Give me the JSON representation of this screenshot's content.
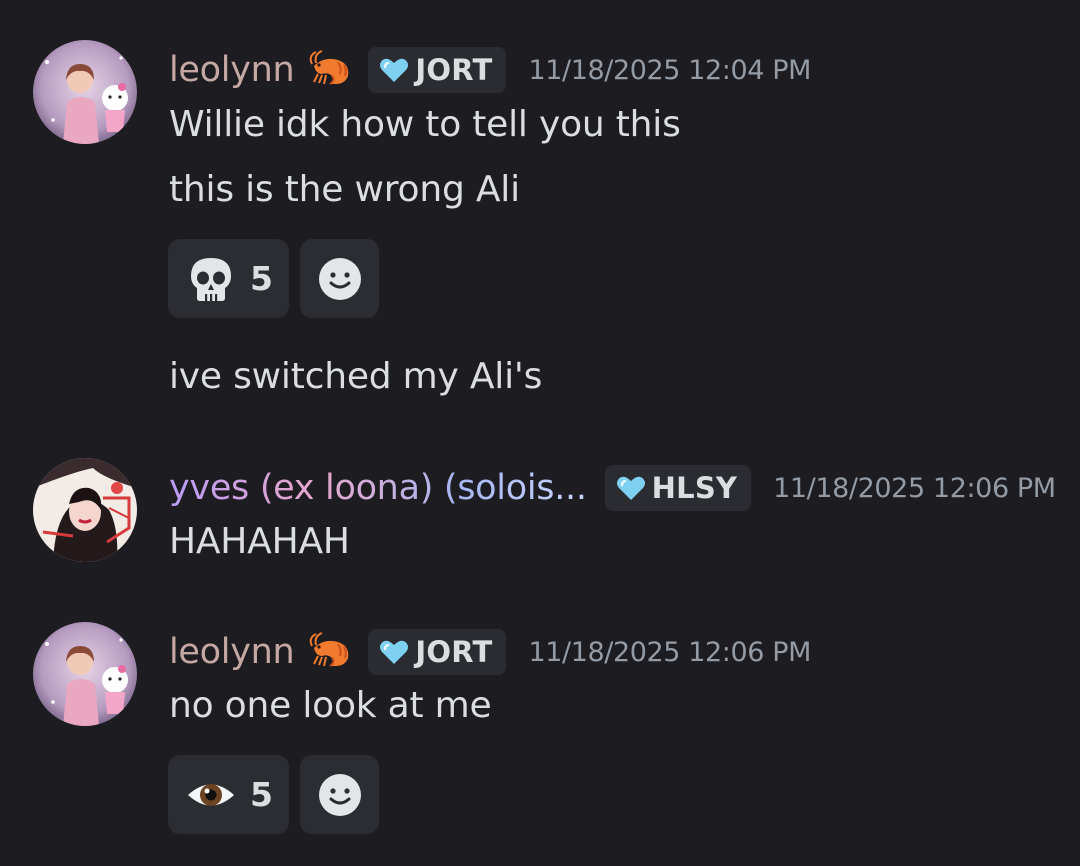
{
  "messages": [
    {
      "author": "leolynn",
      "tag": "JORT",
      "timestamp": "11/18/2025 12:04 PM",
      "lines": [
        "Willie idk how to tell you this",
        "this is the wrong Ali"
      ],
      "reaction": {
        "emoji": "skull-emoji",
        "count": "5"
      },
      "followup": "ive switched my Ali's"
    },
    {
      "author": "yves (ex loona) (solois...",
      "tag": "HLSY",
      "timestamp": "11/18/2025 12:06 PM",
      "lines": [
        "HAHAHAH"
      ]
    },
    {
      "author": "leolynn",
      "tag": "JORT",
      "timestamp": "11/18/2025 12:06 PM",
      "lines": [
        "no one look at me"
      ],
      "reaction": {
        "emoji": "eye-emoji",
        "count": "5"
      }
    }
  ],
  "colors": {
    "background": "#1c1c21",
    "text": "#dbdee1",
    "muted": "#949ba4",
    "leolynn_name": "#c4a8a4",
    "tag_heart": "#7ed0f0",
    "reaction_bg": "#2c2d33"
  },
  "icons": {
    "shrimp": "shrimp-icon",
    "tag": "heart-icon",
    "add_reaction": "smiley-icon"
  }
}
